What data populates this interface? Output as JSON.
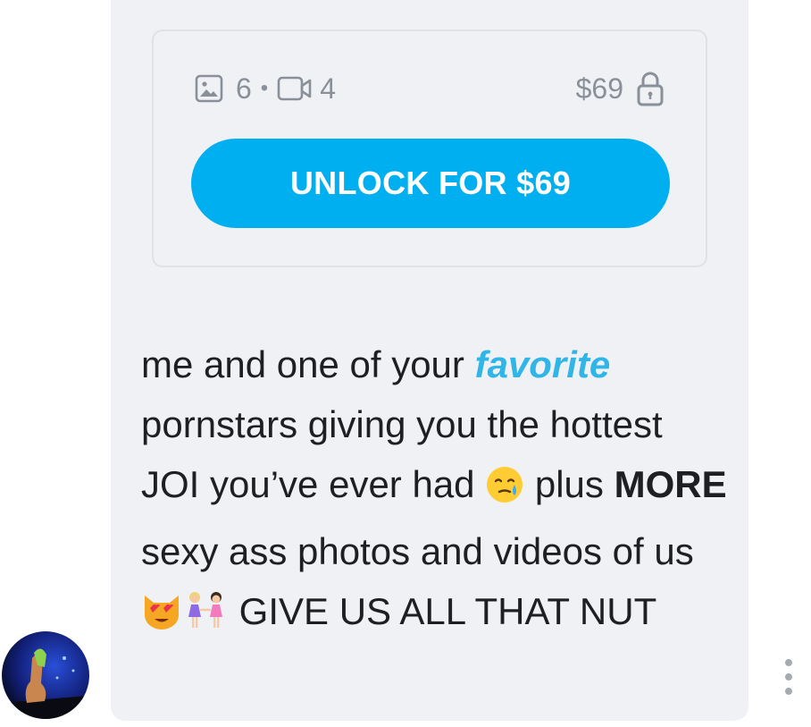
{
  "media": {
    "photo_icon": "image-icon",
    "photo_count": "6",
    "separator": "•",
    "video_icon": "video-icon",
    "video_count": "4",
    "price": "$69",
    "lock_icon": "lock-icon"
  },
  "unlock_button": {
    "label": "UNLOCK FOR $69",
    "color": "#00aff0"
  },
  "message": {
    "part1": "me and one of your ",
    "highlight": "favorite",
    "part2": " pornstars giving you the hottest JOI you’ve ever had ",
    "emoji1": "face-holding-back-tears-emoji",
    "part3": " plus ",
    "bold": "MORE",
    "part4": " sexy ass photos and videos of us ",
    "emoji2": "heart-eyes-cat-emoji",
    "emoji3": "women-holding-hands-emoji",
    "part5": " GIVE US ALL THAT NUT"
  },
  "colors": {
    "accent": "#00aff0",
    "highlight_text": "#2fb5e6",
    "bubble_bg": "#f0f1f4",
    "meta_text": "#8a9099"
  },
  "avatar": {
    "icon": "avatar"
  },
  "more": {
    "icon": "more-vertical-icon"
  }
}
